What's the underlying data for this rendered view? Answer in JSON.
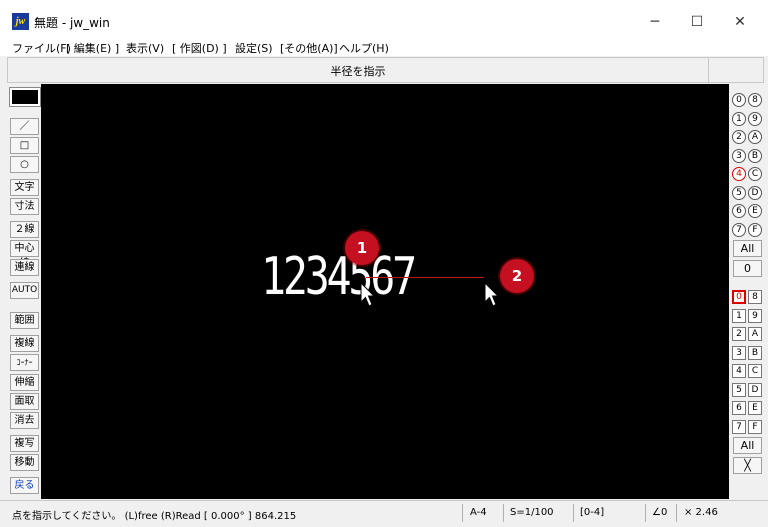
{
  "window": {
    "icon_text": "jw",
    "title": "無題 - jw_win",
    "minimize": "─",
    "maximize": "☐",
    "close": "✕"
  },
  "menu": [
    "ファイル(F)",
    "[ 編集(E) ]",
    "表示(V)",
    "[ 作図(D) ]",
    "設定(S)",
    "[その他(A)]",
    "ヘルプ(H)"
  ],
  "prompt": "半径を指示",
  "tools": {
    "line": "／",
    "rect": "□",
    "circle": "○",
    "text": "文字",
    "dimension": "寸法",
    "double_line": "２線",
    "center_line": "中心線",
    "continuous_line": "連線",
    "auto": "AUTO",
    "range": "範囲",
    "copy_line": "複線",
    "corner": "ｺｰﾅｰ",
    "extend": "伸縮",
    "chamfer": "面取",
    "erase": "消去",
    "copy": "複写",
    "move": "移動",
    "undo": "戻る"
  },
  "layer_groups": [
    "0",
    "1",
    "2",
    "3",
    "4",
    "5",
    "6",
    "7",
    "8",
    "9",
    "A",
    "B",
    "C",
    "D",
    "E",
    "F"
  ],
  "layers": [
    "0",
    "1",
    "2",
    "3",
    "4",
    "5",
    "6",
    "7",
    "8",
    "9",
    "A",
    "B",
    "C",
    "D",
    "E",
    "F"
  ],
  "active_group": "4",
  "active_layer": "0",
  "right_buttons": {
    "all_group": "All",
    "zero": "0",
    "all_layer": "All",
    "cross": "╳"
  },
  "status": {
    "message": "点を指示してください。 (L)free (R)Read [ 0.000° ] 864.215",
    "paper": "A-4",
    "scale": "S=1/100",
    "layer": "[0-4]",
    "angle": "∠0",
    "zoom": "× 2.46"
  },
  "drawing": {
    "text": "1234567"
  },
  "markers": [
    "1",
    "2"
  ]
}
